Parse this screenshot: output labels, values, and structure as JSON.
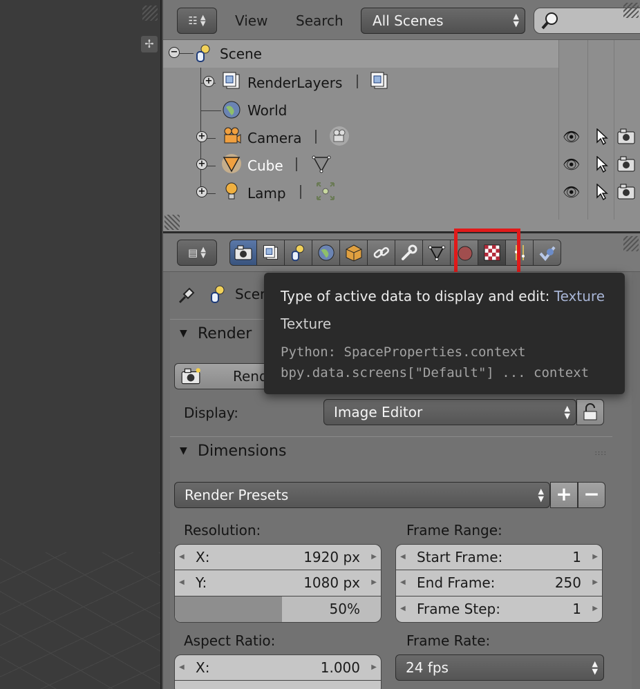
{
  "outliner": {
    "menu": {
      "view": "View",
      "search": "Search"
    },
    "scene_filter": "All Scenes",
    "rows": [
      {
        "label": "Scene",
        "icon": "scene-icon"
      },
      {
        "label": "RenderLayers",
        "icon": "render-layers-icon"
      },
      {
        "label": "World",
        "icon": "world-icon"
      },
      {
        "label": "Camera",
        "icon": "camera-object-icon"
      },
      {
        "label": "Cube",
        "icon": "mesh-object-icon"
      },
      {
        "label": "Lamp",
        "icon": "lamp-object-icon"
      }
    ]
  },
  "properties": {
    "context_tabs": [
      "Render",
      "Render Layers",
      "Scene",
      "World",
      "Object",
      "Constraints",
      "Modifiers",
      "Data",
      "Material",
      "Texture",
      "Particles",
      "Physics"
    ],
    "path_label": "Scene",
    "render_panel": {
      "title": "Render",
      "render_button": "Render",
      "display_label": "Display:",
      "display_value": "Image Editor"
    },
    "dimensions_panel": {
      "title": "Dimensions",
      "presets_label": "Render Presets",
      "resolution_label": "Resolution:",
      "res_x_label": "X:",
      "res_x_value": "1920 px",
      "res_y_label": "Y:",
      "res_y_value": "1080 px",
      "res_pct_value": "50%",
      "res_pct": 0.52,
      "frame_range_label": "Frame Range:",
      "start_label": "Start Frame:",
      "start_value": "1",
      "end_label": "End Frame:",
      "end_value": "250",
      "step_label": "Frame Step:",
      "step_value": "1",
      "aspect_label": "Aspect Ratio:",
      "aspect_x_label": "X:",
      "aspect_x_value": "1.000",
      "frame_rate_label": "Frame Rate:",
      "frame_rate_value": "24 fps"
    }
  },
  "tooltip": {
    "title": "Type of active data to display and edit:",
    "title_value": "Texture",
    "subtitle": "Texture",
    "python_line1": "Python: SpaceProperties.context",
    "python_line2": "bpy.data.screens[\"Default\"] ... context"
  },
  "colors": {
    "highlight_box": "#e11a1a",
    "active_object_text": "#ffffff",
    "tooltip_bg": "#2a2a2a"
  }
}
